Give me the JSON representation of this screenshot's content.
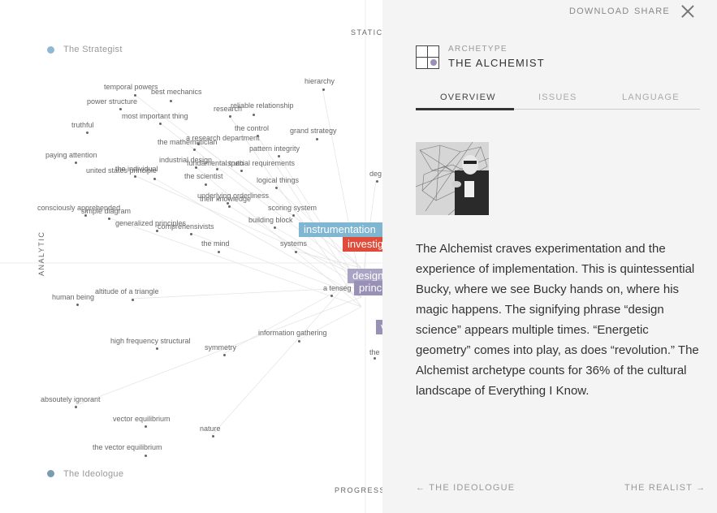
{
  "axes": {
    "top": "STATIC",
    "left": "ANALYTIC",
    "bottom": "PROGRESSIVE"
  },
  "quadrants": [
    {
      "label": "The Strategist",
      "color": "#8fb8d4"
    },
    {
      "label": "The Ideologue",
      "color": "#7a9bb0"
    }
  ],
  "terms": [
    "temporal powers",
    "best mechanics",
    "hierarchy",
    "power structure",
    "research",
    "reliable relationship",
    "most important thing",
    "truthful",
    "the control",
    "grand strategy",
    "a research department",
    "the mathematician",
    "pattern integrity",
    "paying attention",
    "industrial design",
    "fundamental truth",
    "the individual",
    "special requirements",
    "united states principle",
    "the scientist",
    "logical things",
    "underlying orderliness",
    "their knowledge",
    "consciously apprehended",
    "simple diagram",
    "scoring system",
    "building block",
    "generalized principles",
    "comprehensivists",
    "the mind",
    "systems",
    "human being",
    "altitude of a triangle",
    "a tenseg",
    "information gathering",
    "high frequency structural",
    "symmetry",
    "the",
    "absoutely ignorant",
    "vector equilibrium",
    "nature",
    "the vector equilibrium",
    "deg"
  ],
  "highlights": [
    {
      "text": "instrumentation",
      "color": "#7fb6d2"
    },
    {
      "text": "investigation",
      "color": "#e04b3a"
    },
    {
      "text": "design",
      "color": "#a9a3c4"
    },
    {
      "text": "principle",
      "color": "#9990b6"
    },
    {
      "text": "v",
      "color": "#9990b6"
    }
  ],
  "panel": {
    "top": {
      "download": "DOWNLOAD",
      "share": "SHARE"
    },
    "archetype": {
      "kicker": "ARCHETYPE",
      "title": "THE ALCHEMIST",
      "icon": "quadrant-icon"
    },
    "tabs": [
      "OVERVIEW",
      "ISSUES",
      "LANGUAGE"
    ],
    "photo_icon": "portrait-photo",
    "body": "The Alchemist craves experimentation and the experience of implementation. This is quintessential Bucky, where we see Bucky hands on, where his magic happens. The signifying phrase “design science” appears multiple times. “Energetic geometry” comes into play, as does “revolution.” The Alchemist archetype counts for 36% of the cultural landscape of Everything I Know.",
    "nav": {
      "prev": "← THE IDEOLOGUE",
      "next": "THE REALIST →"
    }
  }
}
